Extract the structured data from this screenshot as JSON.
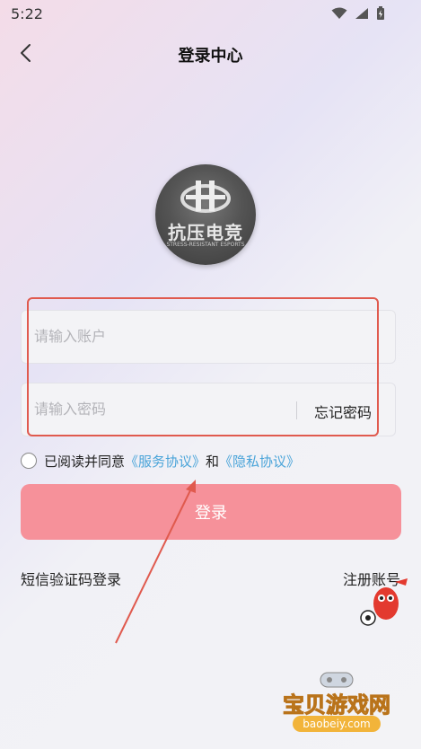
{
  "status_bar": {
    "time": "5:22"
  },
  "header": {
    "title": "登录中心"
  },
  "logo": {
    "name": "抗压电竞",
    "sub": "STRESS-RESISTANT ESPORTS"
  },
  "form": {
    "account_placeholder": "请输入账户",
    "password_placeholder": "请输入密码",
    "forgot_password": "忘记密码"
  },
  "agreement": {
    "prefix": "已阅读并同意",
    "service_link": "《服务协议》",
    "and": "和",
    "privacy_link": "《隐私协议》"
  },
  "actions": {
    "login": "登录",
    "sms_login": "短信验证码登录",
    "register": "注册账号"
  },
  "watermark": {
    "text": "宝贝游戏网",
    "url": "baobeiy.com"
  },
  "colors": {
    "login_button": "#f6919a",
    "link": "#4aa4d9",
    "annotation": "#e05a4e"
  }
}
